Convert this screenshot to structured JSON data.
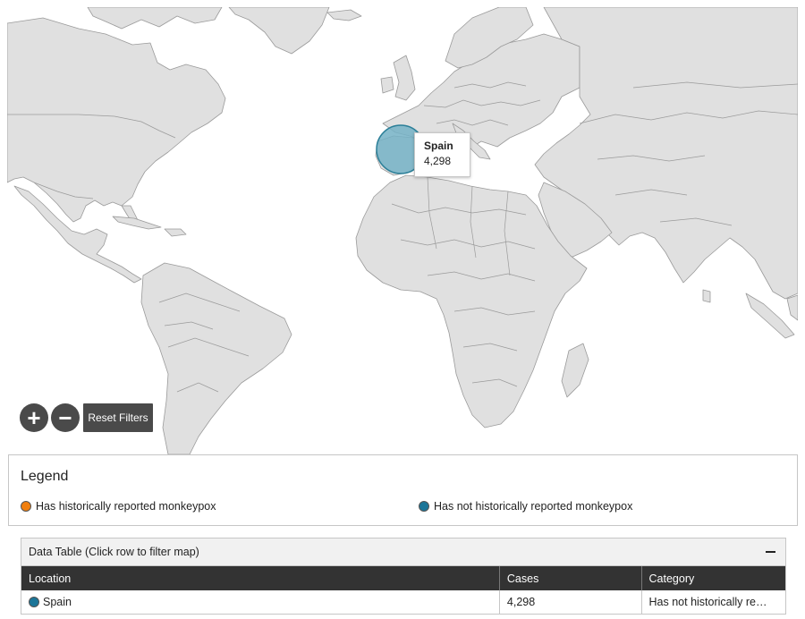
{
  "map": {
    "tooltip": {
      "country": "Spain",
      "value": "4,298"
    },
    "highlighted_country": "Spain",
    "bubble_color": "#74b1c6",
    "bubble_stroke": "#2b7f98",
    "land_color": "#e0e0e0",
    "border_color": "#9a9a9a"
  },
  "controls": {
    "zoom_in_icon": "plus-icon",
    "zoom_in_label": "+",
    "zoom_out_icon": "minus-icon",
    "zoom_out_label": "−",
    "reset_label": "Reset Filters"
  },
  "legend": {
    "title": "Legend",
    "items": [
      {
        "label": "Has historically reported monkeypox",
        "color": "#f07f0e"
      },
      {
        "label": "Has not historically reported monkeypox",
        "color": "#1b7598"
      }
    ]
  },
  "data_table": {
    "title": "Data Table (Click row to filter map)",
    "collapse_icon": "minus-icon",
    "columns": [
      "Location",
      "Cases",
      "Category"
    ],
    "rows": [
      {
        "location": "Spain",
        "cases": "4,298",
        "category": "Has not historically re…",
        "color": "#1b7598"
      }
    ]
  }
}
